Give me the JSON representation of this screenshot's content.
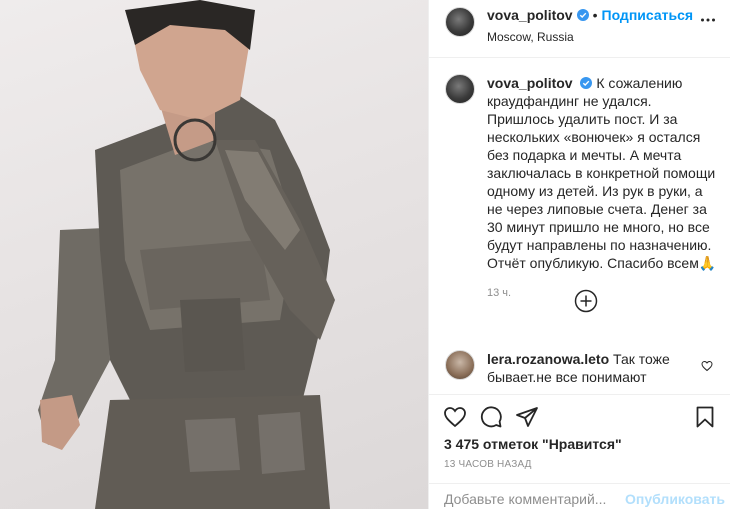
{
  "header": {
    "username": "vova_politov",
    "separator": "•",
    "follow_label": "Подписаться",
    "location": "Moscow, Russia"
  },
  "caption": {
    "username": "vova_politov",
    "text": "К сожалению краудфандинг не удался. Пришлось удалить пост. И за нескольких «вонючек» я остался без подарка и мечты. А мечта заключалась в конкретной помощи одному из детей. Из рук в руки, а не через липовые счета. Денег за 30 минут пришло не много, но все будут направлены по назначению. Отчёт опубликую. Спасибо всем🙏",
    "time": "13 ч."
  },
  "comment": {
    "username": "lera.rozanowa.leto",
    "text": "Так тоже бывает.не все понимают"
  },
  "footer": {
    "likes": "3 475 отметок \"Нравится\"",
    "time_ago": "13 ЧАСОВ НАЗАД",
    "add_comment_placeholder": "Добавьте комментарий...",
    "publish_label": "Опубликовать"
  },
  "colors": {
    "link_blue": "#0095f6",
    "publish_disabled": "#b2dffc",
    "muted_text": "#8e8e8e",
    "divider": "#efefef"
  },
  "icons": [
    "verified-icon",
    "more-options-icon",
    "load-more-comments-icon",
    "like-heart-icon",
    "comment-icon",
    "share-icon",
    "bookmark-icon",
    "comment-like-icon"
  ]
}
